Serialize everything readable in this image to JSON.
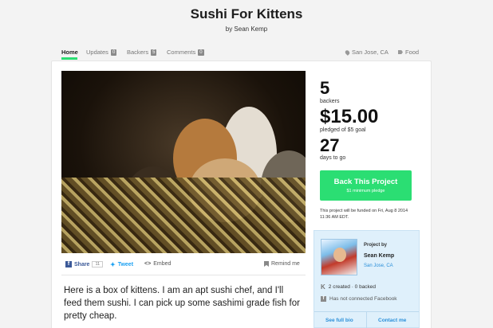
{
  "project": {
    "title": "Sushi For Kittens",
    "byline": "by Sean Kemp"
  },
  "nav": {
    "tabs": [
      {
        "label": "Home",
        "active": true
      },
      {
        "label": "Updates",
        "count": "0"
      },
      {
        "label": "Backers",
        "count": "5"
      },
      {
        "label": "Comments",
        "count": "0"
      }
    ],
    "location": "San Jose, CA",
    "category": "Food"
  },
  "stats": {
    "backers_count": "5",
    "backers_label": "backers",
    "pledged_amount": "$15.00",
    "pledged_label": "pledged of $5 goal",
    "days_count": "27",
    "days_label": "days to go"
  },
  "cta": {
    "button_label": "Back This Project",
    "button_sub": "$1 minimum pledge",
    "funding_note": "This project will be funded on Fri, Aug 8 2014 11:36 AM EDT."
  },
  "creator": {
    "label": "Project by",
    "name": "Sean Kemp",
    "location": "San Jose, CA",
    "created_backed": "2 created · 0 backed",
    "facebook": "Has not connected Facebook",
    "bio_link": "See full bio",
    "contact_link": "Contact me"
  },
  "share": {
    "facebook_label": "Share",
    "facebook_count": "11",
    "tweet_label": "Tweet",
    "embed_label": "Embed",
    "remind_label": "Remind me"
  },
  "description": "Here is a box of kittens. I am an apt sushi chef, and I'll feed them sushi. I can pick up some sashimi grade fish for pretty cheap.",
  "colors": {
    "accent_green": "#2bde73",
    "link_blue": "#2a8fd9",
    "creator_panel_bg": "#dff0fb"
  }
}
